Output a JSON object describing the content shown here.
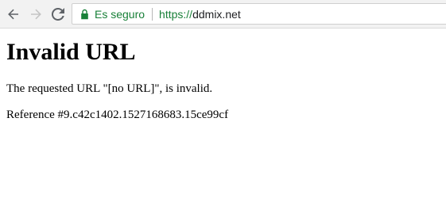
{
  "browser": {
    "security_label": "Es seguro",
    "url_scheme": "https://",
    "url_host": "ddmix.net",
    "secure_color": "#188038",
    "icons": [
      "back-arrow-icon",
      "forward-arrow-icon",
      "reload-icon",
      "lock-icon"
    ]
  },
  "content": {
    "title": "Invalid URL",
    "message": "The requested URL \"[no URL]\", is invalid.",
    "reference": "Reference #9.c42c1402.1527168683.15ce99cf"
  }
}
